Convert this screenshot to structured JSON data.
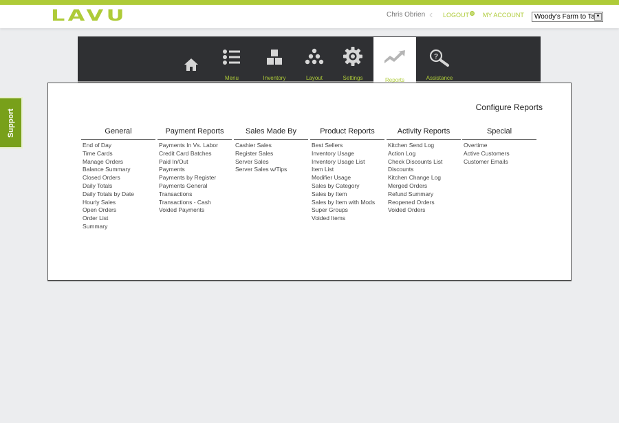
{
  "header": {
    "logo": "LAVU",
    "user_name": "Chris Obrien",
    "logout": "LOGOUT",
    "my_account": "MY ACCOUNT",
    "location_select": "Woody's Farm to Tab",
    "brand_color": "#aecb38"
  },
  "nav": {
    "items": [
      {
        "label": "",
        "icon": "home-icon"
      },
      {
        "label": "Menu",
        "icon": "list-icon"
      },
      {
        "label": "Inventory",
        "icon": "boxes-icon"
      },
      {
        "label": "Layout",
        "icon": "dots-pyramid-icon"
      },
      {
        "label": "Settings",
        "icon": "gear-icon"
      },
      {
        "label": "Reports",
        "icon": "trend-chart-icon",
        "active": true
      },
      {
        "label": "Assistance",
        "icon": "help-magnifier-icon"
      }
    ]
  },
  "support_tab": "Support",
  "panel": {
    "title": "Configure Reports",
    "columns": [
      {
        "heading": "General",
        "items": [
          "End of Day",
          "Time Cards",
          "Manage Orders",
          "Balance Summary",
          "Closed Orders",
          "Daily Totals",
          "Daily Totals  by Date",
          "Hourly Sales",
          "Open Orders",
          "Order List",
          "Summary"
        ]
      },
      {
        "heading": "Payment Reports",
        "items": [
          "Payments In Vs. Labor",
          "Credit Card Batches",
          "Paid In/Out",
          "Payments",
          "Payments by Register",
          "Payments General",
          "Transactions",
          "Transactions - Cash",
          "Voided Payments"
        ]
      },
      {
        "heading": "Sales Made By",
        "items": [
          "Cashier Sales",
          "Register Sales",
          "Server Sales",
          "Server Sales w/Tips"
        ]
      },
      {
        "heading": "Product Reports",
        "items": [
          "Best Sellers",
          "Inventory Usage",
          "Inventory Usage List",
          "Item List",
          "Modifier Usage",
          "Sales by Category",
          "Sales by Item",
          "Sales by Item with Mods",
          "Super Groups",
          "Voided Items"
        ]
      },
      {
        "heading": "Activity Reports",
        "items": [
          "Kitchen Send Log",
          "Action Log",
          "Check Discounts List",
          "Discounts",
          "Kitchen Change Log",
          "Merged Orders",
          "Refund Summary",
          "Reopened Orders",
          "Voided Orders"
        ]
      },
      {
        "heading": "Special",
        "items": [
          "Overtime",
          "Active Customers",
          "Customer Emails"
        ]
      }
    ]
  }
}
